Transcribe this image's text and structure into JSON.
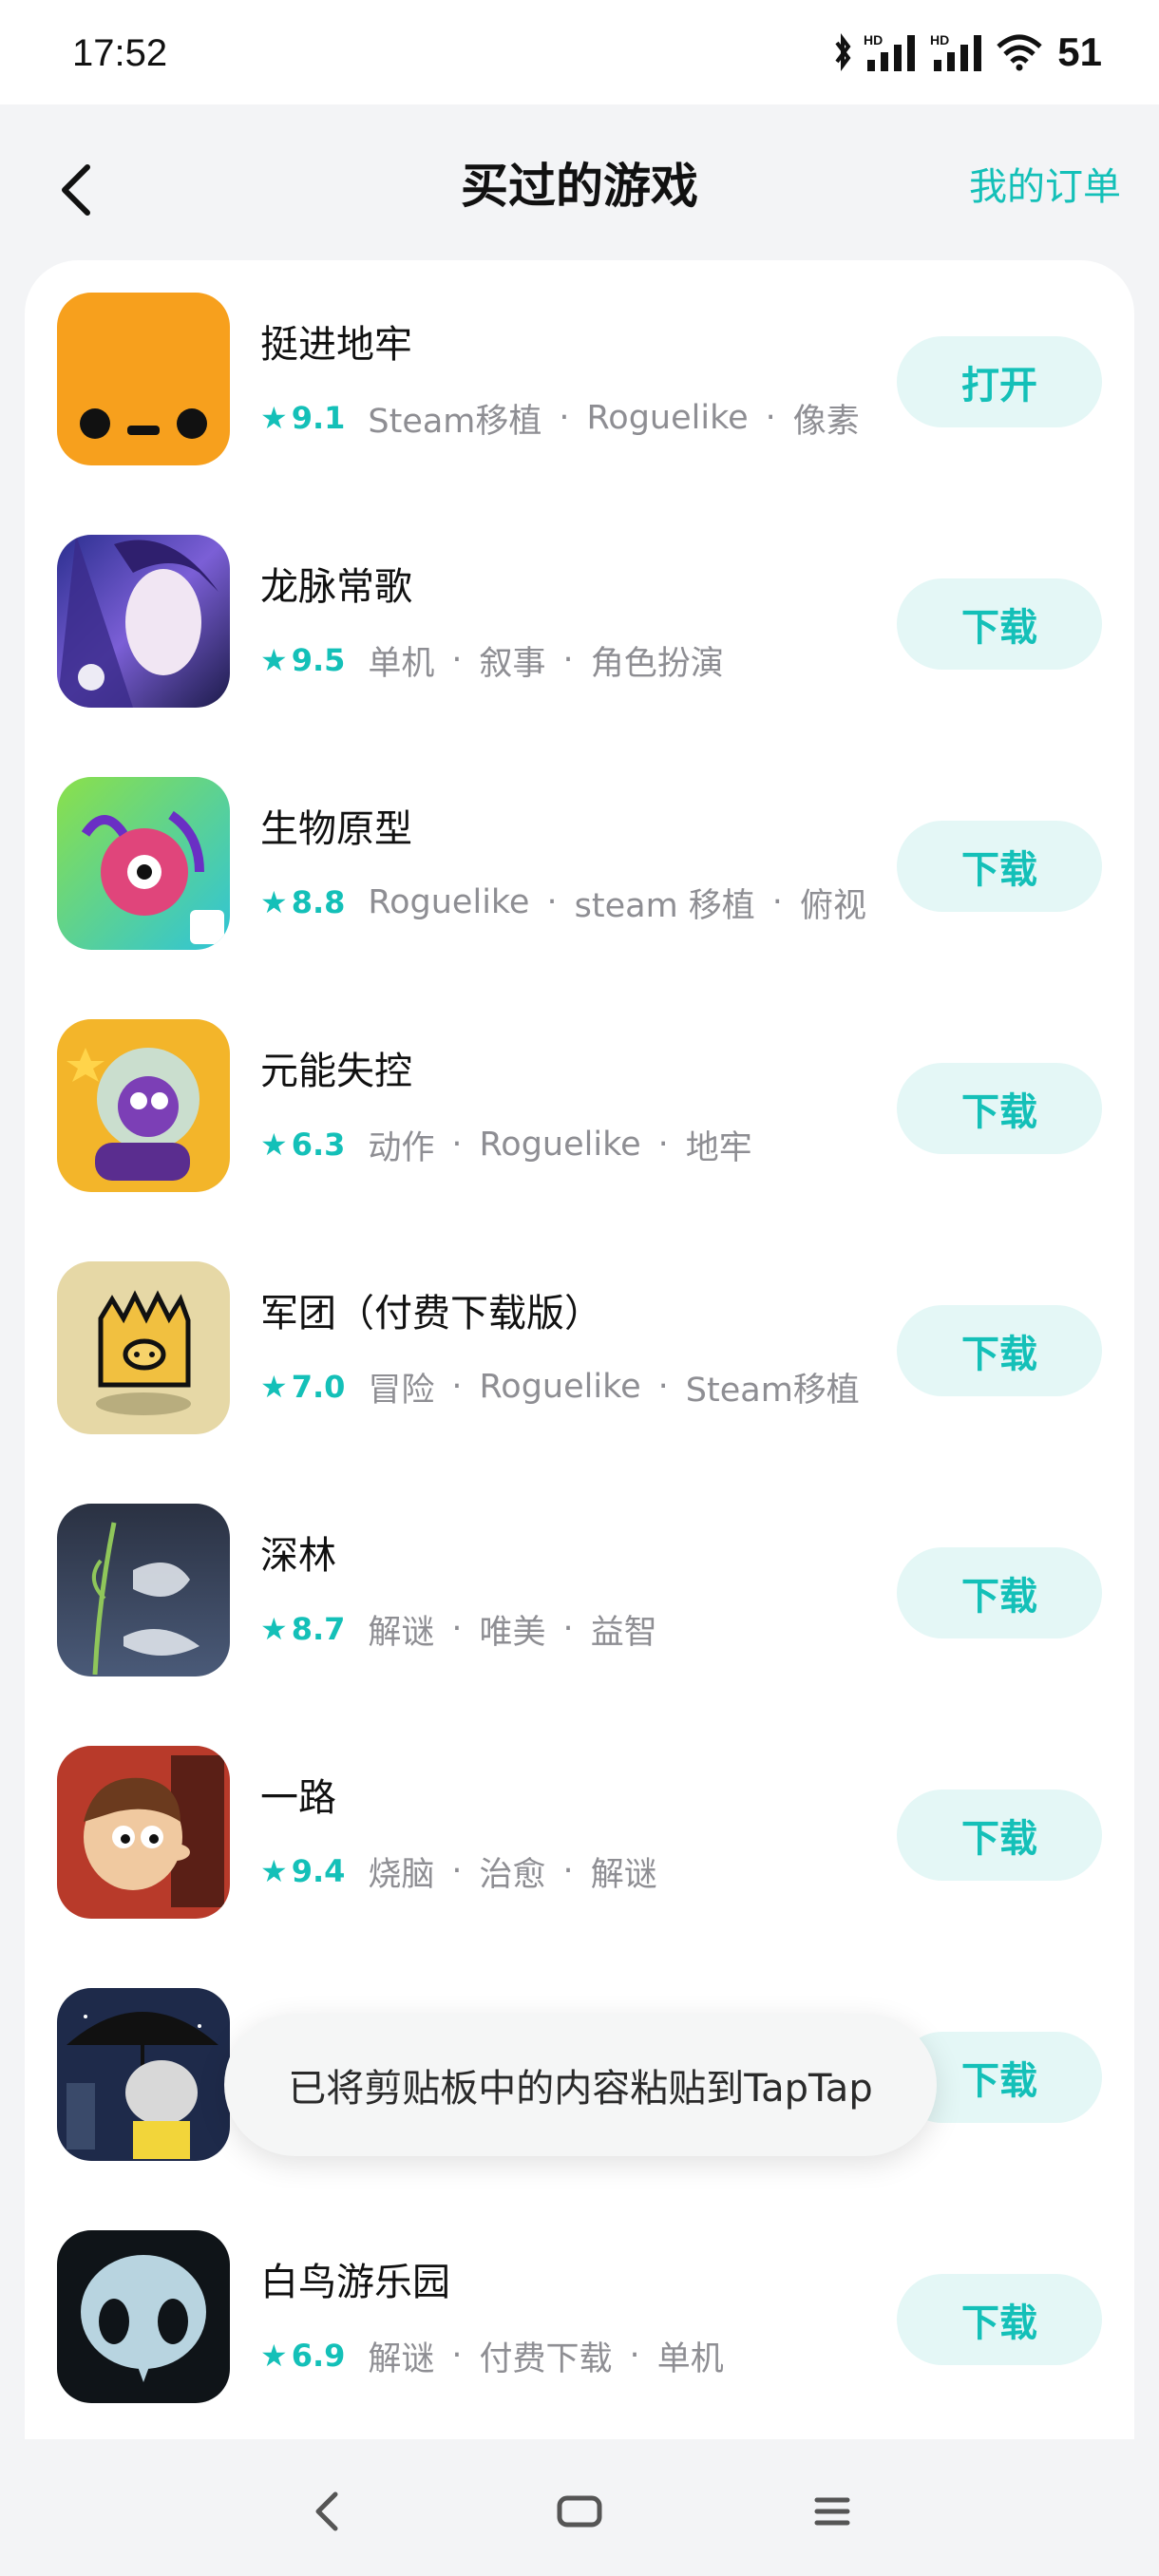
{
  "status_bar": {
    "time": "17:52",
    "battery": "51"
  },
  "header": {
    "title": "买过的游戏",
    "orders_link": "我的订单"
  },
  "colors": {
    "accent": "#14c0b8",
    "button_bg": "#e4f7f6",
    "tag_gray": "#8e8e93"
  },
  "games": [
    {
      "name": "挺进地牢",
      "rating": "9.1",
      "tags": [
        "Steam移植",
        "Roguelike",
        "像素"
      ],
      "action": "打开",
      "icon": "enter-the-gungeon-icon"
    },
    {
      "name": "龙脉常歌",
      "rating": "9.5",
      "tags": [
        "单机",
        "叙事",
        "角色扮演"
      ],
      "action": "下载",
      "icon": "anime-girl-icon"
    },
    {
      "name": "生物原型",
      "rating": "8.8",
      "tags": [
        "Roguelike",
        "steam 移植",
        "俯视"
      ],
      "action": "下载",
      "icon": "creature-icon"
    },
    {
      "name": "元能失控",
      "rating": "6.3",
      "tags": [
        "动作",
        "Roguelike",
        "地牢"
      ],
      "action": "下载",
      "icon": "astronaut-icon"
    },
    {
      "name": "军团（付费下载版）",
      "rating": "7.0",
      "tags": [
        "冒险",
        "Roguelike",
        "Steam移植"
      ],
      "action": "下载",
      "icon": "crowned-pig-icon"
    },
    {
      "name": "深林",
      "rating": "8.7",
      "tags": [
        "解谜",
        "唯美",
        "益智"
      ],
      "action": "下载",
      "icon": "deep-in-the-woods-icon"
    },
    {
      "name": "一路",
      "rating": "9.4",
      "tags": [
        "烧脑",
        "治愈",
        "解谜"
      ],
      "action": "下载",
      "icon": "cartoon-boy-icon"
    },
    {
      "name": "",
      "rating": "",
      "tags": [],
      "action": "下载",
      "icon": "umbrella-cat-icon"
    },
    {
      "name": "白鸟游乐园",
      "rating": "6.9",
      "tags": [
        "解谜",
        "付费下载",
        "单机"
      ],
      "action": "下载",
      "icon": "white-bird-icon"
    }
  ],
  "toast": {
    "message": "已将剪贴板中的内容粘贴到TapTap"
  },
  "nav": {
    "back": "back-icon",
    "home": "home-icon",
    "menu": "menu-icon"
  }
}
